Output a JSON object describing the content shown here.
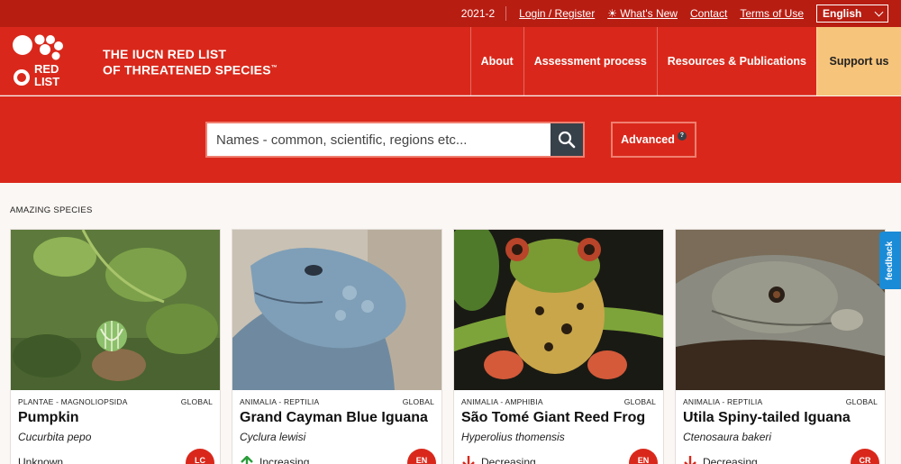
{
  "topbar": {
    "version": "2021-2",
    "login": "Login / Register",
    "whats_new": "☀ What's New",
    "contact": "Contact",
    "terms": "Terms of Use",
    "language": "English"
  },
  "brand": {
    "logo_text_1": "RED",
    "logo_text_2": "LIST",
    "title_line1": "THE IUCN RED LIST",
    "title_line2": "OF THREATENED SPECIES"
  },
  "nav": {
    "about": "About",
    "assessment": "Assessment process",
    "resources": "Resources & Publications",
    "support": "Support us"
  },
  "search": {
    "placeholder": "Names - common, scientific, regions etc...",
    "advanced": "Advanced",
    "help": "?"
  },
  "section": {
    "title": "AMAZING SPECIES"
  },
  "cards": [
    {
      "taxonomy": "PLANTAE - MAGNOLIOPSIDA",
      "scope": "GLOBAL",
      "name": "Pumpkin",
      "scientific": "Cucurbita pepo",
      "trend": "Unknown",
      "status": "LC",
      "status_color": "#d9281b"
    },
    {
      "taxonomy": "ANIMALIA - REPTILIA",
      "scope": "GLOBAL",
      "name": "Grand Cayman Blue Iguana",
      "scientific": "Cyclura lewisi",
      "trend": "Increasing",
      "status": "EN",
      "status_color": "#d9281b"
    },
    {
      "taxonomy": "ANIMALIA - AMPHIBIA",
      "scope": "GLOBAL",
      "name": "São Tomé Giant Reed Frog",
      "scientific": "Hyperolius thomensis",
      "trend": "Decreasing",
      "status": "EN",
      "status_color": "#d9281b"
    },
    {
      "taxonomy": "ANIMALIA - REPTILIA",
      "scope": "GLOBAL",
      "name": "Utila Spiny-tailed Iguana",
      "scientific": "Ctenosaura bakeri",
      "trend": "Decreasing",
      "status": "CR",
      "status_color": "#d9281b"
    }
  ],
  "feedback": "feedback",
  "colors": {
    "brand_red": "#d9281b",
    "dark_red": "#b81d12",
    "support": "#f7c47b",
    "increase": "#2a9d3a",
    "decrease": "#d9281b"
  }
}
